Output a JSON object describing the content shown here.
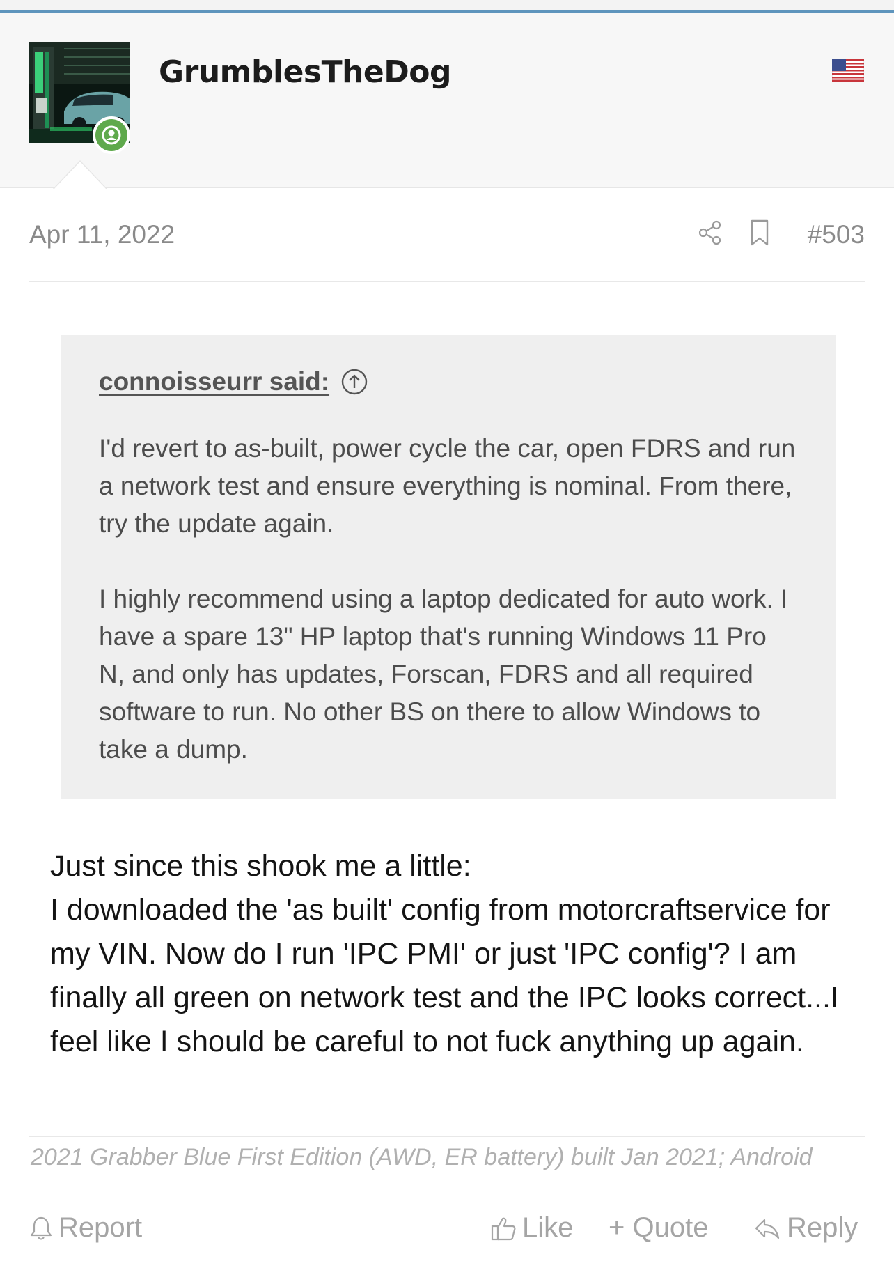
{
  "user": {
    "name": "GrumblesTheDog",
    "status": "online",
    "flag": "US"
  },
  "post": {
    "date": "Apr 11, 2022",
    "number": "#503",
    "quote": {
      "author": "connoisseurr said:",
      "paragraphs": [
        "I'd revert to as-built, power cycle the car, open FDRS and run a network test and ensure everything is nominal. From there, try the update again.",
        "I highly recommend using a laptop dedicated for auto work. I have a spare 13\" HP laptop that's running Windows 11 Pro N, and only has updates, Forscan, FDRS and all required software to run. No other BS on there to allow Windows to take a dump."
      ]
    },
    "body_lines": [
      "Just since this shook me a little:",
      "I downloaded the 'as built' config from motorcraftservice for my VIN. Now do I run 'IPC PMI' or just 'IPC config'? I am finally all green on network test and the IPC looks correct...I feel like I should be careful to not fuck anything up again."
    ],
    "signature": "2021 Grabber Blue First Edition (AWD, ER battery) built Jan 2021; Android"
  },
  "actions": {
    "report": "Report",
    "like": "Like",
    "quote": "+ Quote",
    "reply": "Reply"
  },
  "colors": {
    "accent_line": "#5e95bd",
    "online_green": "#5fa94c",
    "muted_text": "#8a8a8a",
    "quote_bg": "#efefef"
  },
  "icons": [
    "share-icon",
    "bookmark-icon",
    "arrow-up-circle-icon",
    "bell-icon",
    "thumbs-up-icon",
    "reply-arrow-icon",
    "us-flag-icon",
    "user-online-icon"
  ]
}
